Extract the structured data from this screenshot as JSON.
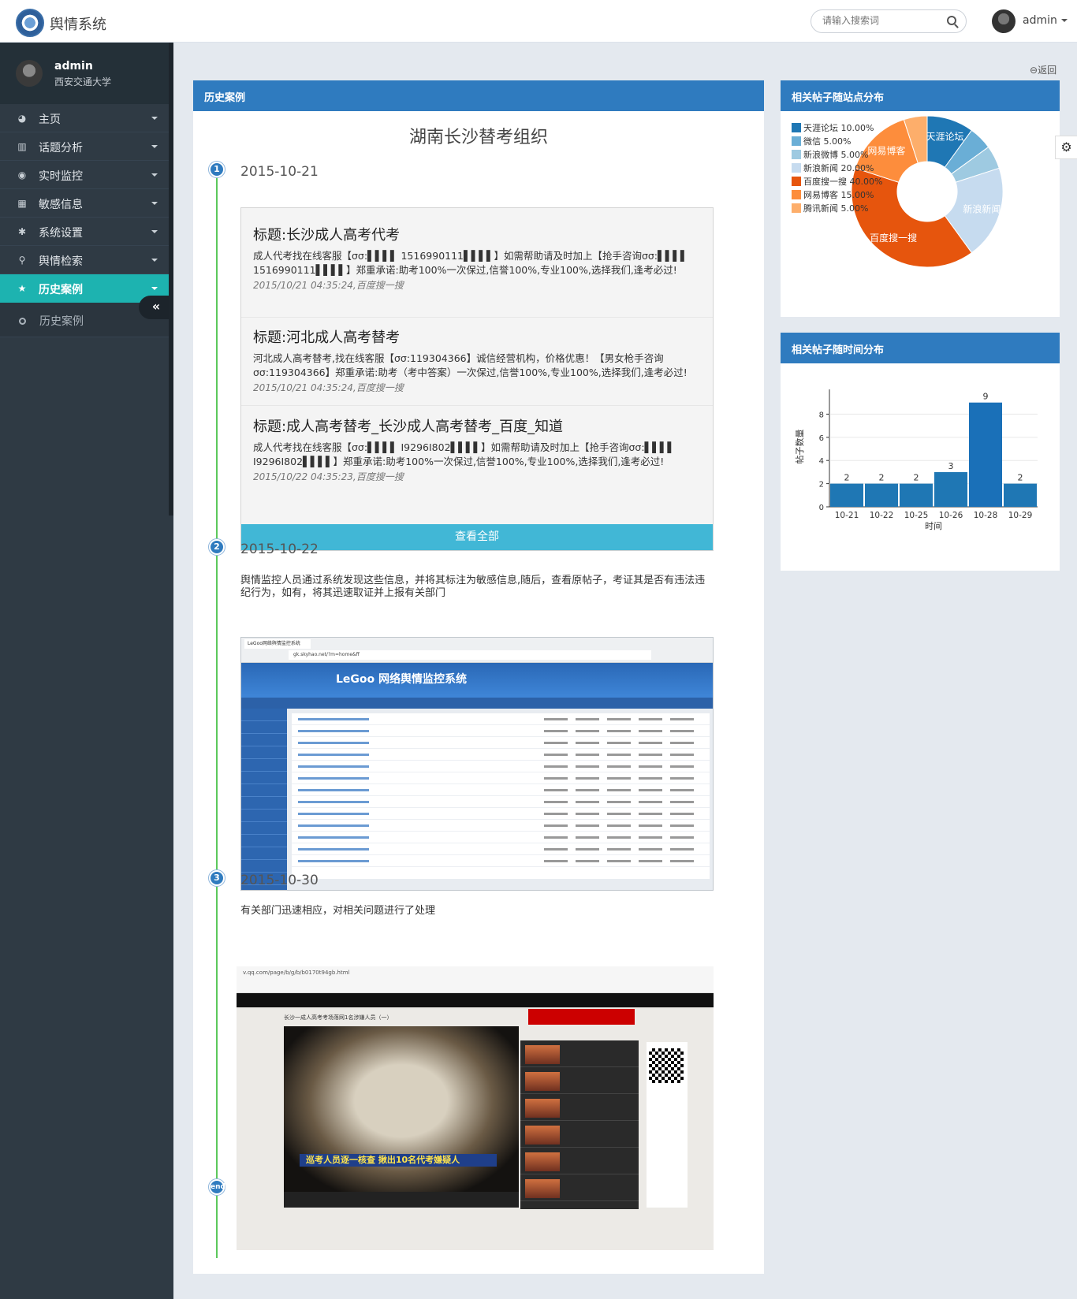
{
  "header": {
    "brand": "舆情系统",
    "search_placeholder": "请输入搜索词",
    "user": "admin"
  },
  "sidebar": {
    "profile": {
      "name": "admin",
      "org": "西安交通大学"
    },
    "items": [
      {
        "label": "主页",
        "icon": "dashboard-icon"
      },
      {
        "label": "话题分析",
        "icon": "bar-chart-icon"
      },
      {
        "label": "实时监控",
        "icon": "eye-icon"
      },
      {
        "label": "敏感信息",
        "icon": "table-icon"
      },
      {
        "label": "系统设置",
        "icon": "gear-icon"
      },
      {
        "label": "舆情检索",
        "icon": "search-icon"
      },
      {
        "label": "历史案例",
        "icon": "star-icon",
        "active": true
      }
    ],
    "subitem": "历史案例",
    "collapse_label": "«"
  },
  "back_label": "返回",
  "main": {
    "panel_title": "历史案例",
    "case_title": "湖南长沙替考组织",
    "timeline": [
      {
        "num": "1",
        "date": "2015-10-21"
      },
      {
        "num": "2",
        "date": "2015-10-22",
        "text": "舆情监控人员通过系统发现这些信息，并将其标注为敏感信息,随后，查看原帖子，考证其是否有违法违纪行为，如有，将其迅速取证并上报有关部门"
      },
      {
        "num": "3",
        "date": "2015-10-30",
        "text": "有关部门迅速相应，对相关问题进行了处理"
      },
      {
        "num": "end"
      }
    ],
    "posts": [
      {
        "title": "标题:长沙成人高考代考",
        "body": "成人代考找在线客服【σσ:▌▌▌▌ 1516990111▌▌▌▌】如需帮助请及时加上【抢手咨询σσ:▌▌▌▌ 1516990111▌▌▌▌】郑重承诺:助考100%一次保过,信誉100%,专业100%,选择我们,逢考必过!",
        "meta": "2015/10/21 04:35:24,百度搜一搜"
      },
      {
        "title": "标题:河北成人高考替考",
        "body": "河北成人高考替考,找在线客服【σσ:119304366】诚信经营机构，价格优惠！【男女枪手咨询σσ:119304366】郑重承诺:助考（考中答案）一次保过,信誉100%,专业100%,选择我们,逢考必过!",
        "meta": "2015/10/21 04:35:24,百度搜一搜"
      },
      {
        "title": "标题:成人高考替考_长沙成人高考替考_百度_知道",
        "body": "成人代考找在线客服【σσ:▌▌▌▌ I9296I802▌▌▌▌】如需帮助请及时加上【抢手咨询σσ:▌▌▌▌ I9296I802▌▌▌▌】郑重承诺:助考100%一次保过,信誉100%,专业100%,选择我们,逢考必过!",
        "meta": "2015/10/22 04:35:23,百度搜一搜"
      }
    ],
    "view_all": "查看全部",
    "shot1": {
      "tab": "LeGoo网络舆情监控系统",
      "url": "gk.skyhao.net/?m=home&ff",
      "title": "LeGoo 网络舆情监控系统"
    },
    "shot2": {
      "url": "v.qq.com/page/b/g/b/b0170t94gb.html",
      "title": "长沙一成人高考考场落网1名涉嫌人员（一）",
      "caption": "巡考人员逐一核查 揪出10名代考嫌疑人"
    }
  },
  "pie_panel": {
    "title": "相关帖子随站点分布",
    "chart_data": {
      "type": "pie",
      "title": "",
      "categories": [
        "天涯论坛",
        "微信",
        "新浪微博",
        "新浪新闻",
        "百度搜一搜",
        "网易博客",
        "腾讯新闻"
      ],
      "values": [
        10,
        5,
        5,
        20,
        40,
        15,
        5
      ],
      "value_labels": [
        "10.00%",
        "5.00%",
        "5.00%",
        "20.00%",
        "40.00%",
        "15.00%",
        "5.00%"
      ],
      "slice_labels": [
        "天涯论坛",
        "",
        "",
        "新浪新闻",
        "百度搜一搜",
        "网易博客",
        ""
      ],
      "colors": [
        "#1f77b4",
        "#6aaed6",
        "#9ecae1",
        "#c6dbef",
        "#e6550d",
        "#fd8d3c",
        "#fdae6b"
      ],
      "donut": true,
      "legend": "left"
    }
  },
  "bar_panel": {
    "title": "相关帖子随时间分布",
    "chart_data": {
      "type": "bar",
      "title": "",
      "categories": [
        "10-21",
        "10-22",
        "10-25",
        "10-26",
        "10-28",
        "10-29"
      ],
      "values": [
        2,
        2,
        2,
        3,
        9,
        2
      ],
      "highlight_index": 4,
      "xlabel": "时间",
      "ylabel": "帖子数量",
      "yticks": [
        0,
        2,
        4,
        6,
        8
      ],
      "ylim": [
        0,
        10
      ],
      "colors": {
        "bar": "#1f77b4",
        "highlight": "#1a70b8"
      }
    }
  }
}
